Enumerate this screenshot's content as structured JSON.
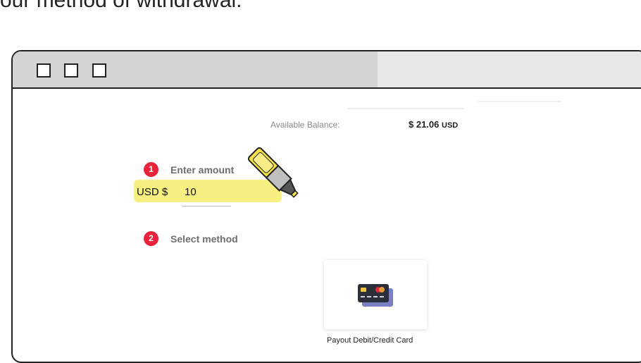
{
  "heading": "our method of withdrawal.",
  "balance": {
    "label": "Available Balance:",
    "amount": "$ 21.06",
    "currency": "USD"
  },
  "steps": [
    {
      "number": "1",
      "label": "Enter amount"
    },
    {
      "number": "2",
      "label": "Select method"
    }
  ],
  "amount_input": {
    "prefix": "USD $",
    "value": "10"
  },
  "methods": [
    {
      "icon": "credit-card-icon",
      "label": "Payout Debit/Credit Card"
    }
  ],
  "colors": {
    "accent_red": "#e8233b",
    "highlight_yellow": "#f7ef7a",
    "pen_yellow": "#f5e24a"
  }
}
